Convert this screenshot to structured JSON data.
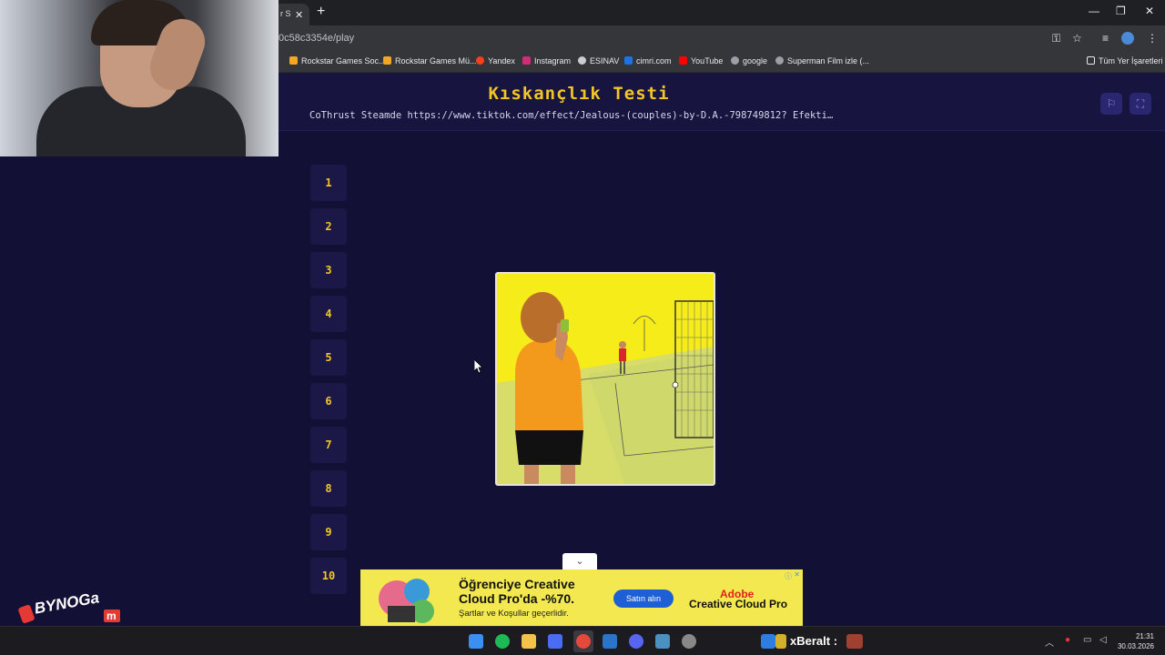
{
  "browser": {
    "tab_label": "r S",
    "url": "0c58c3354e/play",
    "bookmarks": [
      {
        "label": "Rockstar Games Soc...",
        "color": "#f5a623"
      },
      {
        "label": "Rockstar Games Mü...",
        "color": "#f5a623"
      },
      {
        "label": "Yandex",
        "color": "#fc3f1d"
      },
      {
        "label": "Instagram",
        "color": "#d62976"
      },
      {
        "label": "ESINAV",
        "color": "#cccccc"
      },
      {
        "label": "cimri.com",
        "color": "#1a73e8"
      },
      {
        "label": "YouTube",
        "color": "#ff0000"
      },
      {
        "label": "google",
        "color": "#9aa0a6"
      },
      {
        "label": "Superman Film izle (...",
        "color": "#9aa0a6"
      }
    ],
    "all_bookmarks": "Tüm Yer İşaretleri"
  },
  "page": {
    "title": "Kıskançlık Testi",
    "description": "CoThrust Steamde https://www.tiktok.com/effect/Jealous-(couples)-by-D.A.-798749812? Efekti…"
  },
  "numbers": [
    "1",
    "2",
    "3",
    "4",
    "5",
    "6",
    "7",
    "8",
    "9",
    "10"
  ],
  "ad": {
    "headline": "Öğrenciye Creative Cloud Pro'da -%70.",
    "sub": "Şartlar ve Koşullar geçerlidir.",
    "button": "Satın alın",
    "brand1": "Adobe",
    "brand2": "Creative Cloud Pro"
  },
  "watermark": "BYNOGaM",
  "taskbar": {
    "stream_tag": "xBeralt :",
    "time": "21:31",
    "date": "30.03.2026"
  },
  "colors": {
    "page_bg": "#131035",
    "accent": "#f3c625",
    "image_bg": "#f5ec1a"
  }
}
